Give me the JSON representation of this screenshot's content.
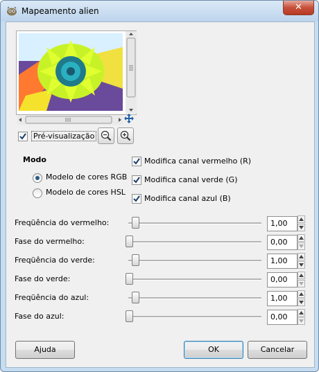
{
  "window": {
    "title": "Mapeamento alien",
    "close_glyph": "✕"
  },
  "preview": {
    "label": "Pré-visualização",
    "checked": true
  },
  "modo": {
    "heading": "Modo",
    "options": [
      {
        "label": "Modelo de cores RGB",
        "selected": true
      },
      {
        "label": "Modelo de cores HSL",
        "selected": false
      }
    ]
  },
  "channels": [
    {
      "label": "Modifica canal vermelho (R)",
      "checked": true
    },
    {
      "label": "Modifica canal verde (G)",
      "checked": true
    },
    {
      "label": "Modifica canal azul (B)",
      "checked": true
    }
  ],
  "params": [
    {
      "label": "Freqüência do vermelho:",
      "value": "1,00"
    },
    {
      "label": "Fase do vermelho:",
      "value": "0,00"
    },
    {
      "label": "Freqüência do verde:",
      "value": "1,00"
    },
    {
      "label": "Fase do verde:",
      "value": "0,00"
    },
    {
      "label": "Freqüência do azul:",
      "value": "1,00"
    },
    {
      "label": "Fase do azul:",
      "value": "0,00"
    }
  ],
  "buttons": {
    "help": "Ajuda",
    "ok": "OK",
    "cancel": "Cancelar"
  },
  "colors": {
    "titlebar": "#c6dcf1",
    "client": "#f0f0f0",
    "accent": "#3c7fb1"
  }
}
